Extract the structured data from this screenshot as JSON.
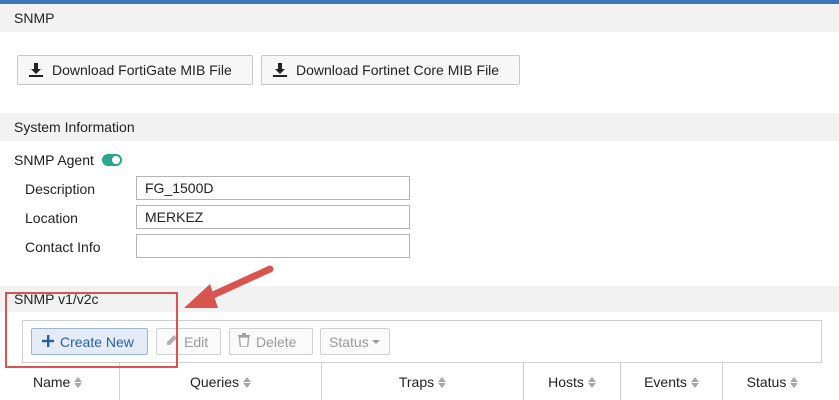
{
  "sections": {
    "snmp": "SNMP",
    "system_information": "System Information",
    "v1v2c": "SNMP v1/v2c"
  },
  "downloads": {
    "fortigate_label": "Download FortiGate MIB File",
    "fortinet_core_label": "Download Fortinet Core MIB File",
    "icon": "download-icon"
  },
  "agent": {
    "label": "SNMP Agent",
    "enabled": true
  },
  "fields": {
    "description_label": "Description",
    "description_value": "FG_1500D",
    "location_label": "Location",
    "location_value": "MERKEZ",
    "contact_label": "Contact Info",
    "contact_value": ""
  },
  "toolbar": {
    "create_new": "Create New",
    "edit": "Edit",
    "delete": "Delete",
    "status": "Status"
  },
  "table": {
    "columns": [
      "Name",
      "Queries",
      "Traps",
      "Hosts",
      "Events",
      "Status"
    ]
  },
  "colors": {
    "accent": "#3a73b8",
    "toggle_on": "#2aa68c",
    "callout": "#d9534f"
  }
}
